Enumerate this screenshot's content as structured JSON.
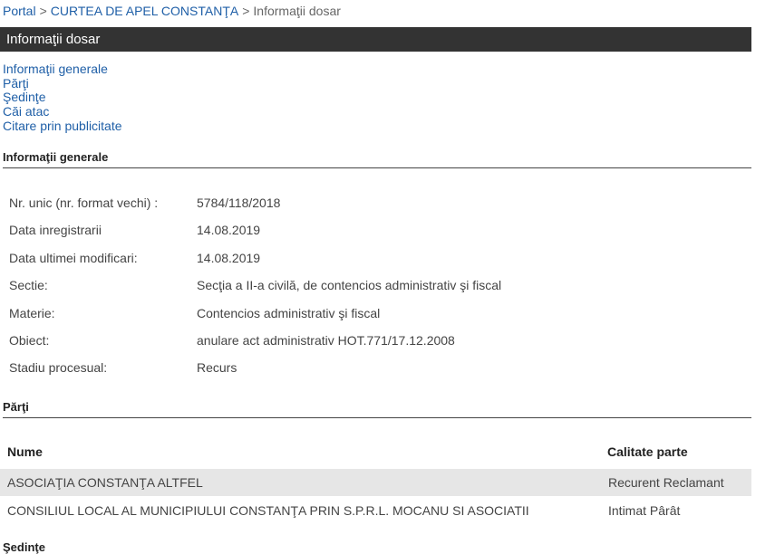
{
  "breadcrumb": {
    "items": [
      "Portal",
      "CURTEA DE APEL CONSTANŢA",
      "Informaţii dosar"
    ],
    "separator": ">"
  },
  "titlebar": {
    "title": "Informaţii dosar"
  },
  "nav": {
    "items": [
      "Informaţii generale",
      "Părţi",
      "Şedinţe",
      "Căi atac",
      "Citare prin publicitate"
    ]
  },
  "general": {
    "heading": "Informaţii generale",
    "rows": [
      {
        "label": "Nr. unic (nr. format vechi) :",
        "value": "5784/118/2018"
      },
      {
        "label": "Data inregistrarii",
        "value": "14.08.2019"
      },
      {
        "label": "Data ultimei modificari:",
        "value": "14.08.2019"
      },
      {
        "label": "Sectie:",
        "value": "Secţia a II-a civilă, de contencios administrativ şi fiscal"
      },
      {
        "label": "Materie:",
        "value": "Contencios administrativ şi fiscal"
      },
      {
        "label": "Obiect:",
        "value": "anulare act administrativ HOT.771/17.12.2008"
      },
      {
        "label": "Stadiu procesual:",
        "value": "Recurs"
      }
    ]
  },
  "parti": {
    "heading": "Părţi",
    "columns": [
      "Nume",
      "Calitate parte"
    ],
    "rows": [
      {
        "nume": "ASOCIAŢIA CONSTANŢA ALTFEL",
        "calitate": "Recurent Reclamant"
      },
      {
        "nume": "CONSILIUL LOCAL AL MUNICIPIULUI CONSTANŢA PRIN S.P.R.L. MOCANU SI ASOCIATII",
        "calitate": "Intimat Pârât"
      }
    ]
  },
  "sedinte": {
    "heading": "Şedinţe"
  },
  "colors": {
    "titlebar_bg": "#333333",
    "link": "#1f5fa7",
    "row_shade": "#e6e6e6"
  }
}
